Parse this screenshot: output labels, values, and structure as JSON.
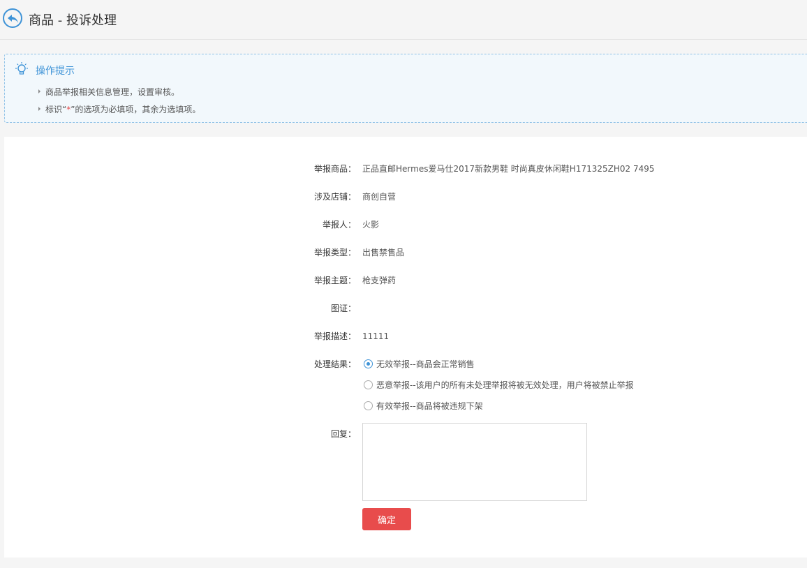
{
  "header": {
    "title": "商品 - 投诉处理"
  },
  "tips": {
    "title": "操作提示",
    "line1": "商品举报相关信息管理，设置审核。",
    "line2_before": "标识“",
    "line2_req": "*",
    "line2_after": "”的选项为必填项，其余为选填项。"
  },
  "form": {
    "goods_label": "举报商品：",
    "goods_value": "正品直邮Hermes爱马仕2017新款男鞋 时尚真皮休闲鞋H171325ZH02 7495",
    "shop_label": "涉及店铺：",
    "shop_value": "商创自营",
    "reporter_label": "举报人：",
    "reporter_value": "火影",
    "type_label": "举报类型：",
    "type_value": "出售禁售品",
    "subject_label": "举报主题：",
    "subject_value": "枪支弹药",
    "evidence_label": "图证：",
    "desc_label": "举报描述：",
    "desc_value": "11111",
    "result_label": "处理结果：",
    "result_options": [
      "无效举报--商品会正常销售",
      "恶意举报--该用户的所有未处理举报将被无效处理，用户将被禁止举报",
      "有效举报--商品将被违规下架"
    ],
    "result_selected": "无效举报--商品会正常销售",
    "reply_label": "回复：",
    "reply_value": "",
    "submit_label": "确定"
  },
  "colors": {
    "accent": "#3e93d7",
    "submit": "#e84c4c"
  }
}
